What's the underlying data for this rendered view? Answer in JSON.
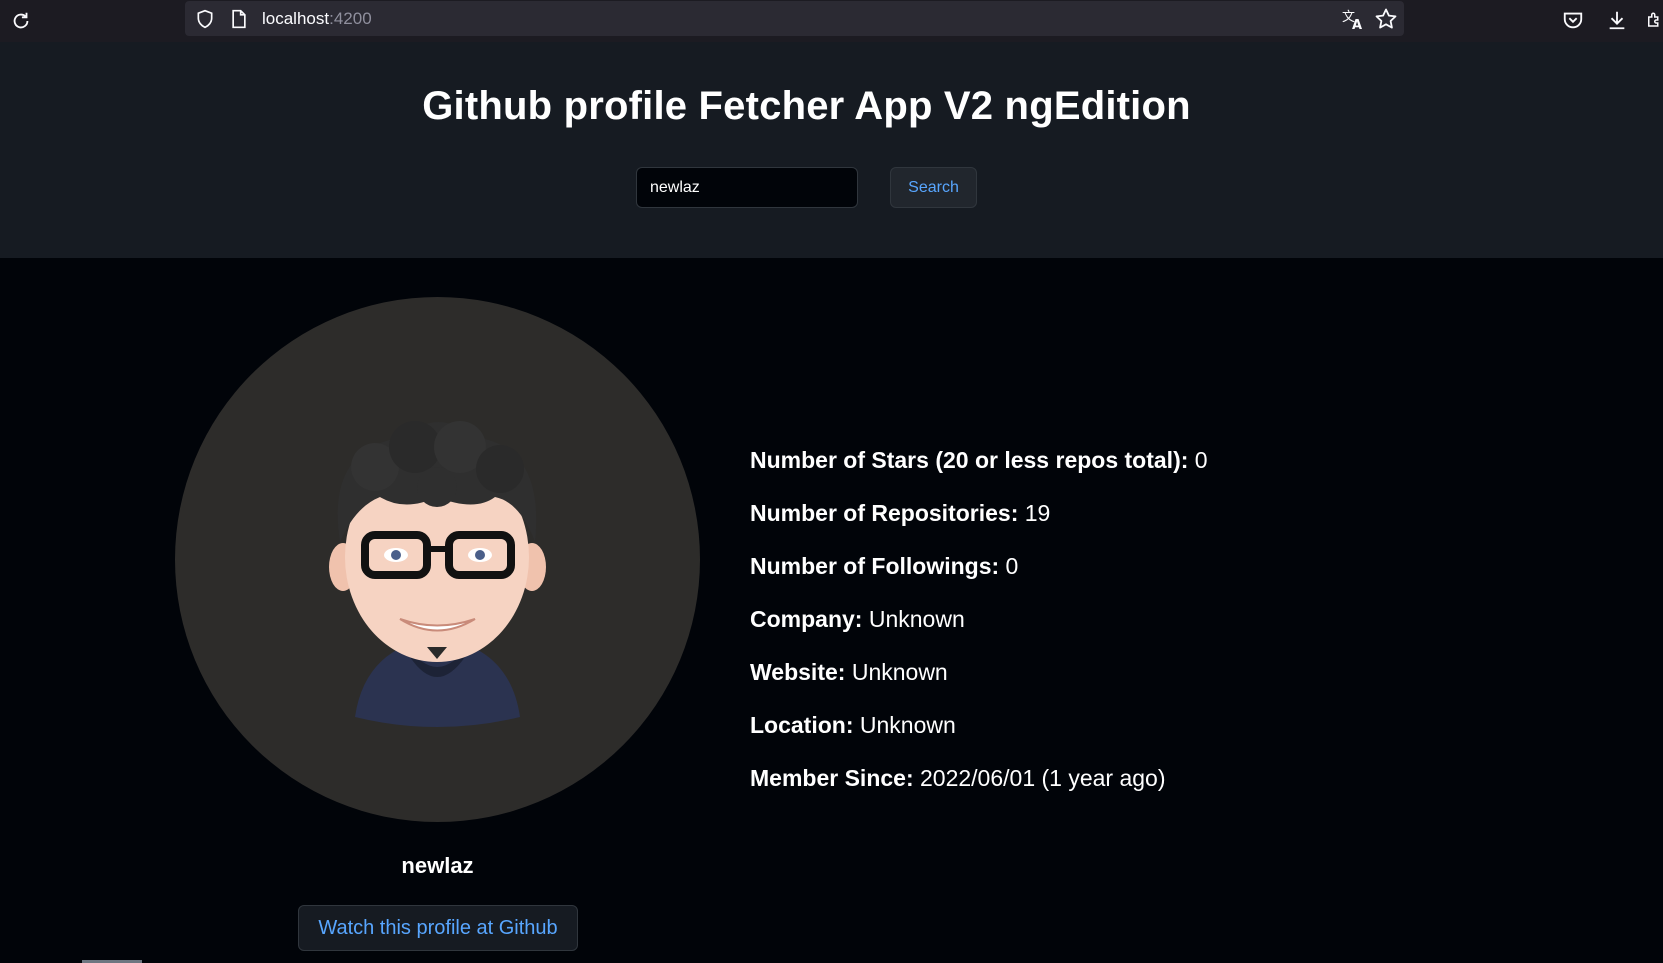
{
  "browser": {
    "url_host": "localhost",
    "url_port": ":4200"
  },
  "header": {
    "title": "Github profile Fetcher App V2 ngEdition",
    "search_value": "newlaz",
    "search_button": "Search"
  },
  "profile": {
    "username": "newlaz",
    "github_button": "Watch this profile at Github"
  },
  "stats": [
    {
      "label": "Number of Stars (20 or less repos total):",
      "value": "0"
    },
    {
      "label": "Number of Repositories:",
      "value": "19"
    },
    {
      "label": "Number of Followings:",
      "value": "0"
    },
    {
      "label": "Company:",
      "value": "Unknown"
    },
    {
      "label": "Website:",
      "value": "Unknown"
    },
    {
      "label": "Location:",
      "value": "Unknown"
    },
    {
      "label": "Member Since:",
      "value": "2022/06/01 (1 year ago)"
    }
  ],
  "icons": {
    "reload": "reload-icon",
    "shield": "shield-icon",
    "page": "page-icon",
    "translate": "translate-icon",
    "bookmark": "star-icon",
    "pocket": "pocket-icon",
    "download": "download-icon",
    "extensions": "extensions-icon"
  },
  "colors": {
    "page_bg": "#010409",
    "header_bg": "#161b22",
    "accent": "#58a6ff"
  }
}
